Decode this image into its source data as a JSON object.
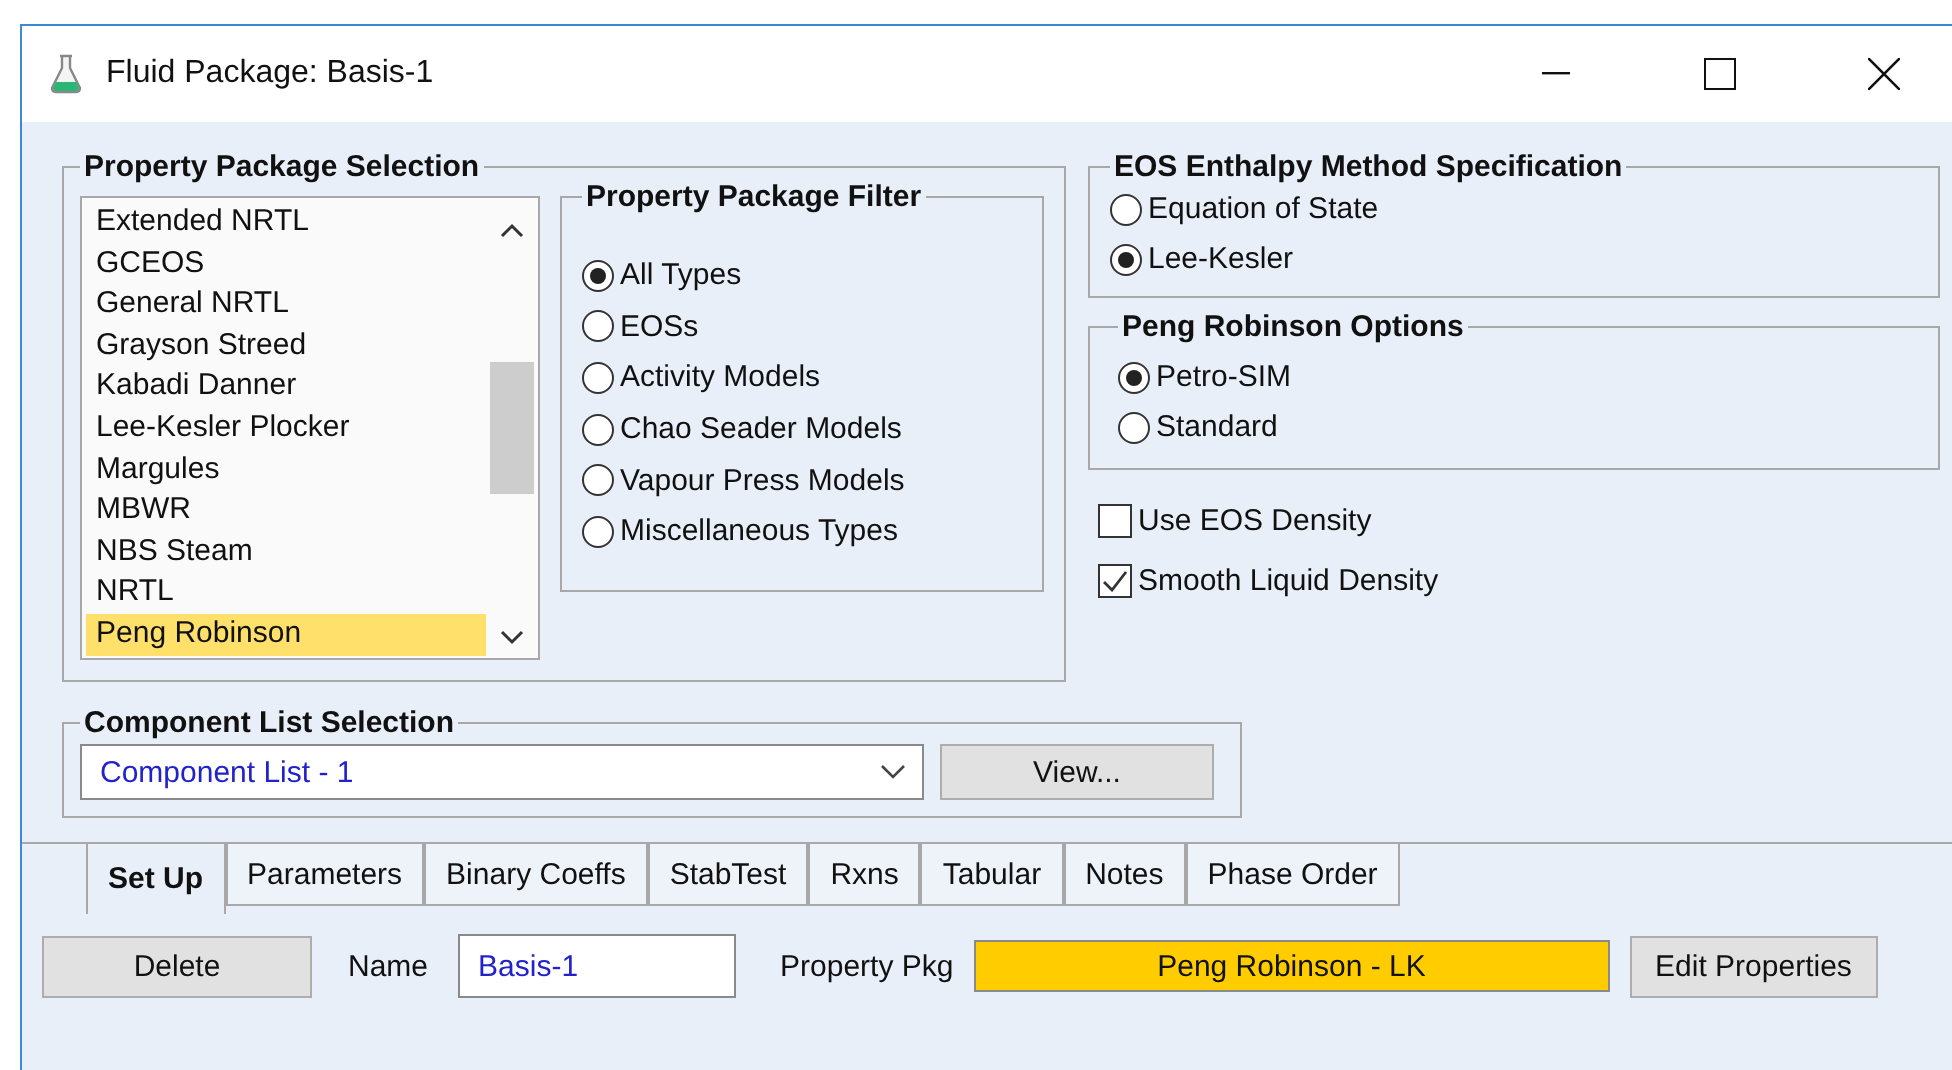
{
  "window": {
    "title": "Fluid Package: Basis-1"
  },
  "property_package_selection": {
    "title": "Property Package Selection",
    "packages": [
      {
        "label": "Extended NRTL",
        "selected": false
      },
      {
        "label": "GCEOS",
        "selected": false
      },
      {
        "label": "General NRTL",
        "selected": false
      },
      {
        "label": "Grayson Streed",
        "selected": false
      },
      {
        "label": "Kabadi Danner",
        "selected": false
      },
      {
        "label": "Lee-Kesler Plocker",
        "selected": false
      },
      {
        "label": "Margules",
        "selected": false
      },
      {
        "label": "MBWR",
        "selected": false
      },
      {
        "label": "NBS Steam",
        "selected": false
      },
      {
        "label": "NRTL",
        "selected": false
      },
      {
        "label": "Peng Robinson",
        "selected": true
      }
    ],
    "filter": {
      "title": "Property Package Filter",
      "options": [
        {
          "label": "All Types",
          "selected": true
        },
        {
          "label": "EOSs",
          "selected": false
        },
        {
          "label": "Activity Models",
          "selected": false
        },
        {
          "label": "Chao Seader Models",
          "selected": false
        },
        {
          "label": "Vapour Press Models",
          "selected": false
        },
        {
          "label": "Miscellaneous Types",
          "selected": false
        }
      ]
    }
  },
  "eos_enthalpy": {
    "title": "EOS Enthalpy Method Specification",
    "options": [
      {
        "label": "Equation of State",
        "selected": false
      },
      {
        "label": "Lee-Kesler",
        "selected": true
      }
    ]
  },
  "peng_robinson_options": {
    "title": "Peng Robinson Options",
    "options": [
      {
        "label": "Petro-SIM",
        "selected": true
      },
      {
        "label": "Standard",
        "selected": false
      }
    ]
  },
  "checkboxes": [
    {
      "label": "Use EOS Density",
      "checked": false
    },
    {
      "label": "Smooth Liquid Density",
      "checked": true
    }
  ],
  "component_list_selection": {
    "title": "Component List Selection",
    "value": "Component List - 1",
    "button": "View..."
  },
  "tabs": [
    {
      "label": "Set Up",
      "selected": true
    },
    {
      "label": "Parameters",
      "selected": false
    },
    {
      "label": "Binary Coeffs",
      "selected": false
    },
    {
      "label": "StabTest",
      "selected": false
    },
    {
      "label": "Rxns",
      "selected": false
    },
    {
      "label": "Tabular",
      "selected": false
    },
    {
      "label": "Notes",
      "selected": false
    },
    {
      "label": "Phase Order",
      "selected": false
    }
  ],
  "setup": {
    "delete_button": "Delete",
    "name_label": "Name",
    "name_value": "Basis-1",
    "property_pkg_label": "Property Pkg",
    "property_pkg_value": "Peng Robinson - LK",
    "edit_button": "Edit Properties"
  }
}
